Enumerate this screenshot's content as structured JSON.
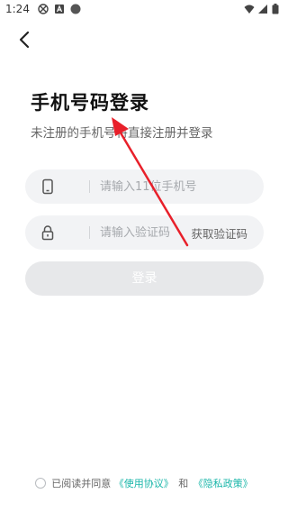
{
  "status_bar": {
    "time": "1:24",
    "left_icons": [
      "notification-muted-icon",
      "notification-a-icon",
      "notification-dot-icon"
    ],
    "right_icons": [
      "wifi-icon",
      "signal-icon",
      "battery-icon"
    ]
  },
  "header": {
    "back_icon": "back-chevron-icon"
  },
  "page": {
    "title": "手机号码登录",
    "subtitle": "未注册的手机号将直接注册并登录"
  },
  "phone_field": {
    "icon": "phone-icon",
    "placeholder": "请输入11位手机号",
    "value": ""
  },
  "code_field": {
    "icon": "lock-icon",
    "placeholder": "请输入验证码",
    "value": "",
    "get_code_label": "获取验证码"
  },
  "login_button": {
    "label": "登录",
    "enabled": false
  },
  "agreement": {
    "prefix": "已阅读并同意",
    "user_agreement": "《使用协议》",
    "conjunction": "和",
    "privacy_policy": "《隐私政策》",
    "checked": false
  },
  "colors": {
    "accent_link": "#19b6a9",
    "annotation_arrow": "#e8202a",
    "field_bg": "#f2f3f5",
    "button_disabled": "#e7e8ea"
  }
}
